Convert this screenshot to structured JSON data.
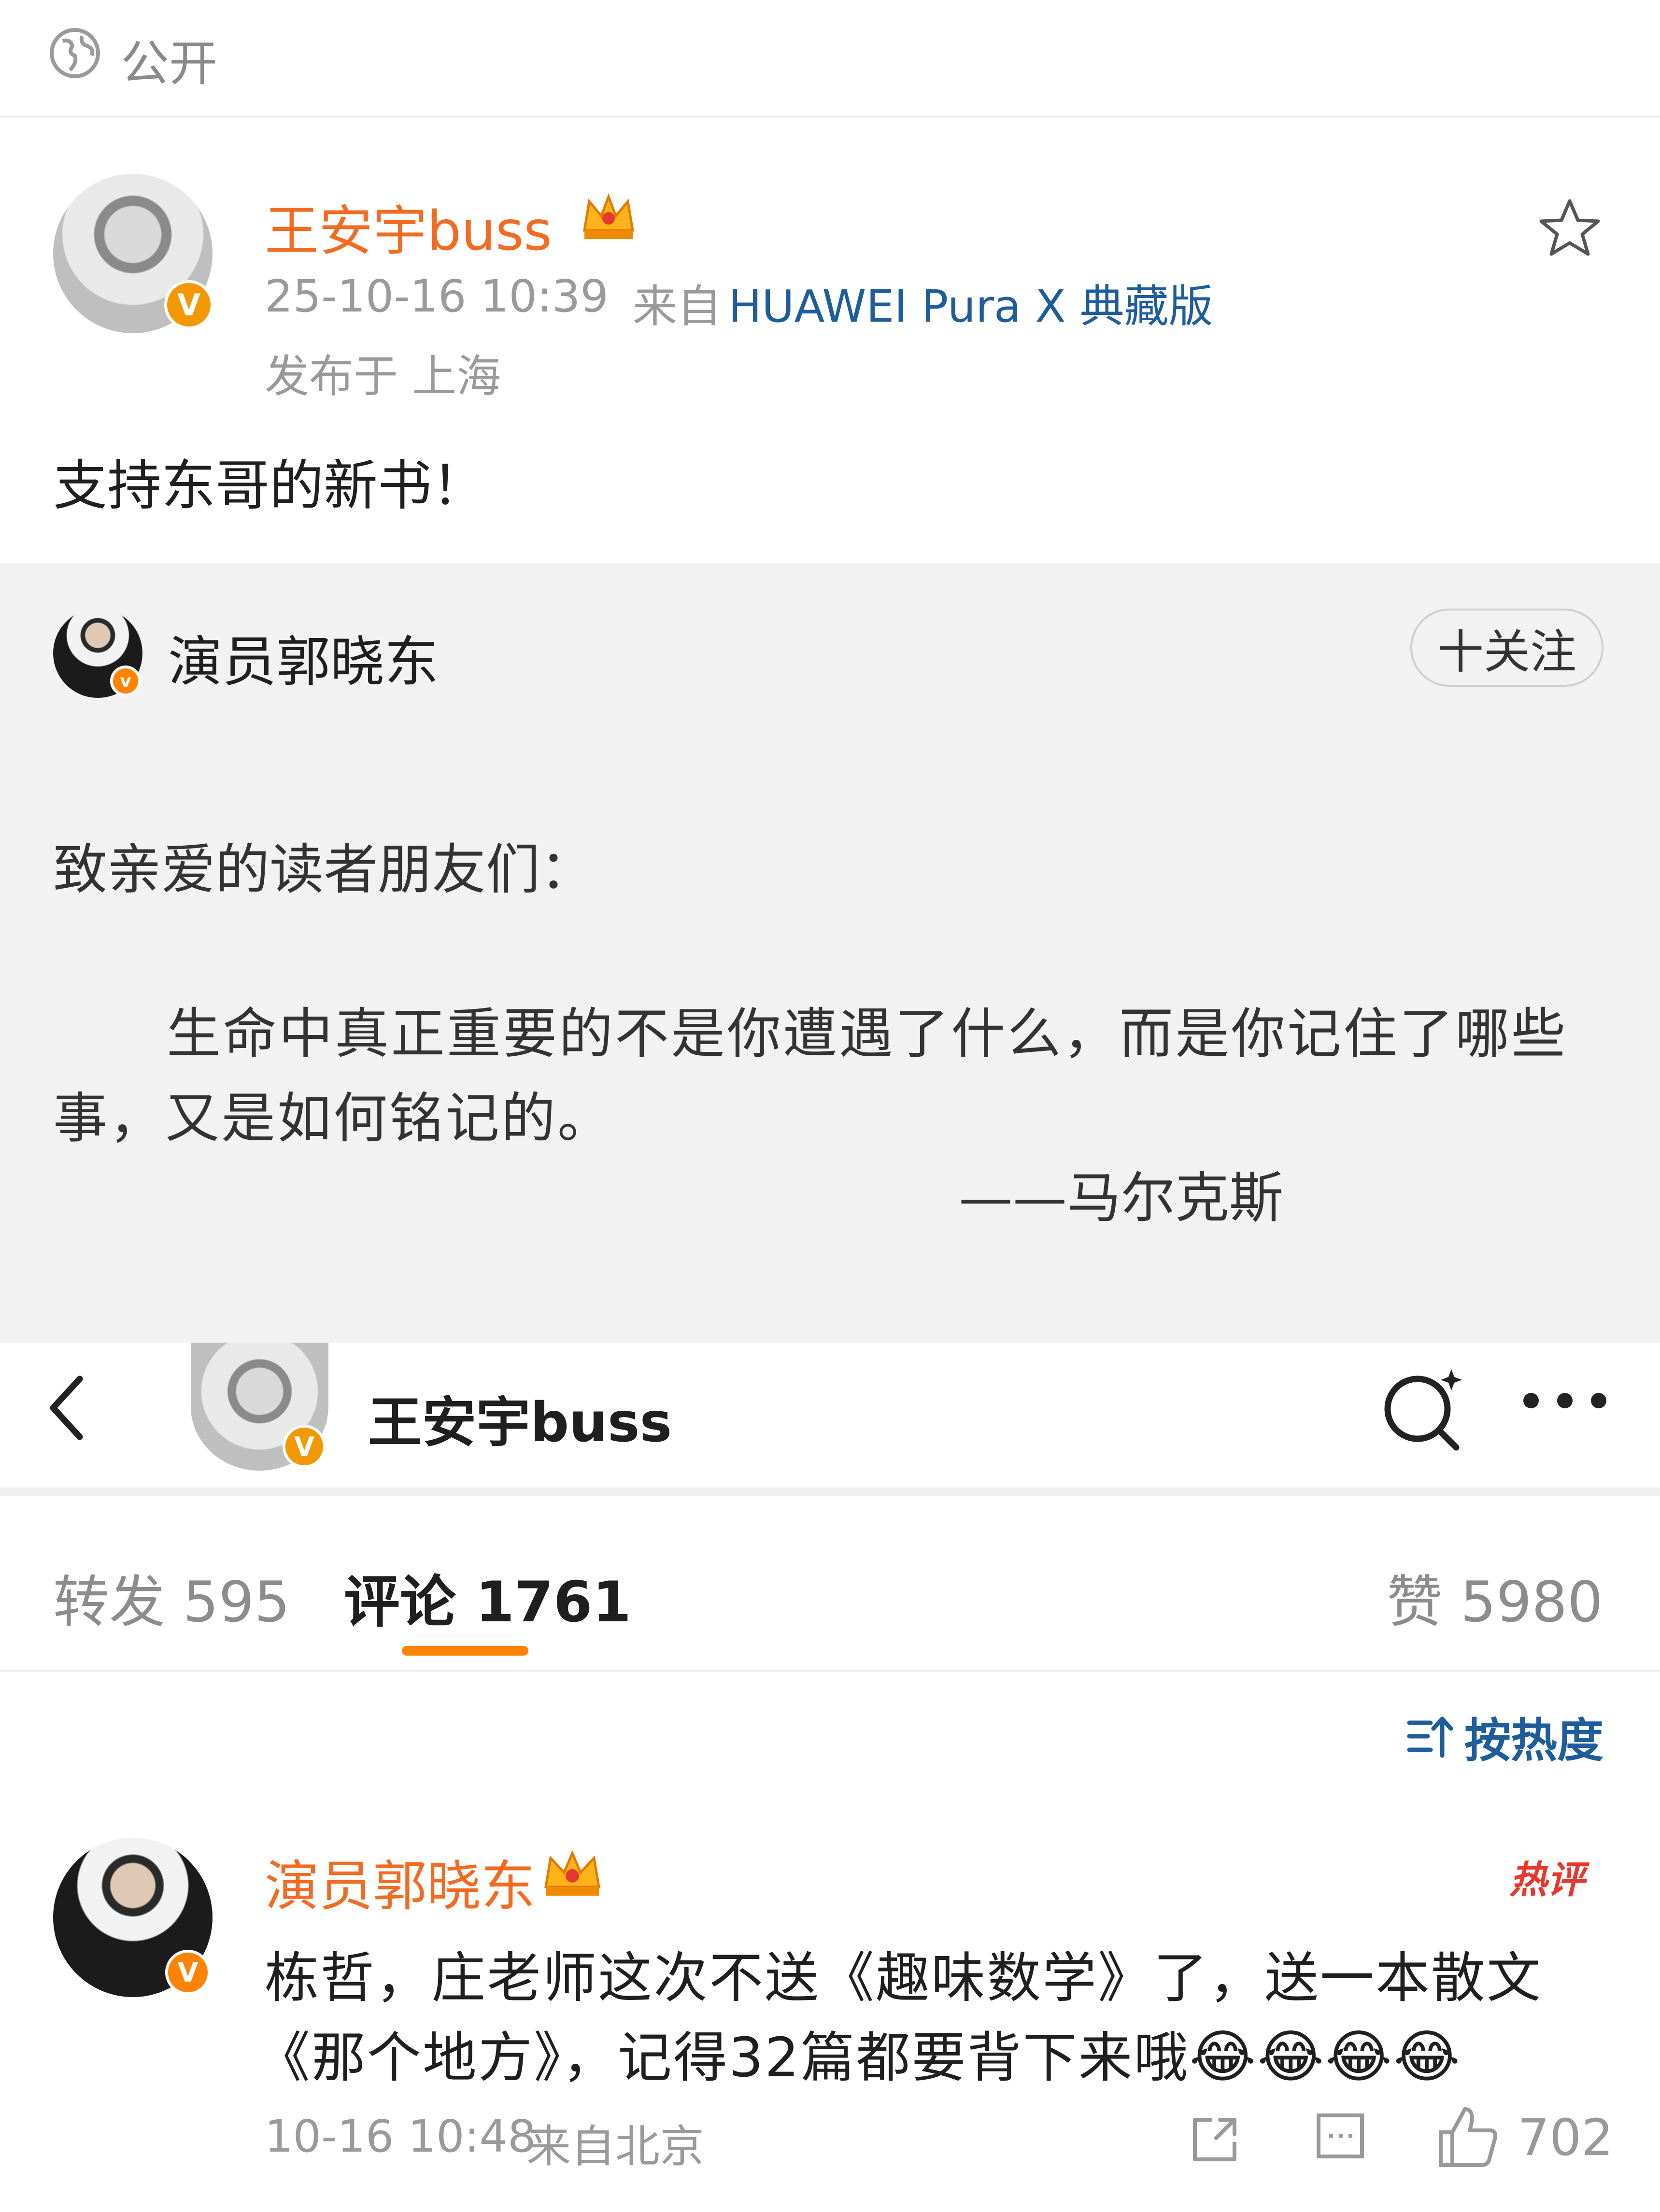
{
  "visibility": {
    "label": "公开",
    "icon": "globe-icon"
  },
  "post": {
    "author": "王安宇buss",
    "author_badge": "crown-icon",
    "verified_badge": "V",
    "time": "25-10-16 10:39",
    "source_prefix": "来自",
    "device": "HUAWEI Pura X 典藏版",
    "location": "发布于 上海",
    "content": "支持东哥的新书！"
  },
  "repost": {
    "author": "演员郭晓东",
    "follow_label": "十关注",
    "greeting": "致亲爱的读者朋友们：",
    "quote_line1": "生命中真正重要的不是你遭遇了什么，而是你记住了哪些",
    "quote_line2": "事，又是如何铭记的。",
    "attribution": "——马尔克斯"
  },
  "header": {
    "title": "王安宇buss",
    "back_icon": "chevron-left-icon",
    "search_icon": "search-sparkle-icon",
    "more_icon": "more-icon"
  },
  "tabs": {
    "repost_label": "转发 595",
    "comment_label": "评论 1761",
    "like_label": "赞 5980"
  },
  "sort": {
    "label": "按热度",
    "icon": "sort-icon"
  },
  "comment": {
    "author": "演员郭晓东",
    "badge": "热评",
    "text_line1": "栋哲，庄老师这次不送《趣味数学》了，送一本散文",
    "text_line2": "《那个地方》，记得32篇都要背下来哦",
    "emojis": "😂😂😂😂",
    "time": "10-16 10:48",
    "source": "来自北京",
    "like_count": "702"
  },
  "colors": {
    "accent_orange": "#ff8200",
    "name_orange": "#f26b21",
    "link_blue": "#1e5d9c",
    "grey_text": "#999999",
    "repost_bg": "#f2f2f2"
  }
}
